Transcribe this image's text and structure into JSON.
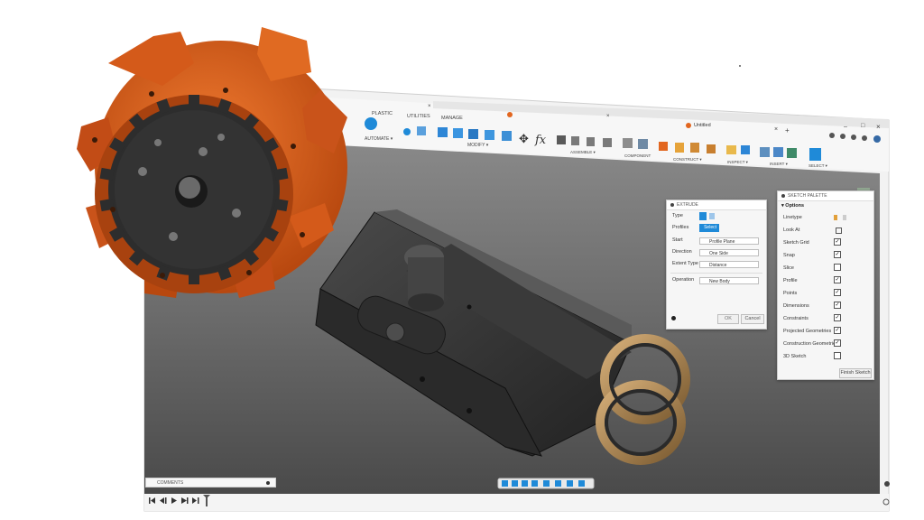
{
  "toolbar": {
    "tabs": [
      "PLASTIC",
      "UTILITIES",
      "MANAGE"
    ],
    "groups": [
      "AUTOMATE ▾",
      "MODIFY ▾",
      "ASSEMBLE ▾",
      "COMPONENT",
      "CONSTRUCT ▾",
      "INSPECT ▾",
      "INSERT ▾",
      "SELECT ▾"
    ]
  },
  "document_tab": {
    "title": "Untitled",
    "close_glyph": "×",
    "add_glyph": "+"
  },
  "window_controls": {
    "minimize": "–",
    "maximize": "□",
    "close": "×"
  },
  "extrude": {
    "title": "EXTRUDE",
    "rows": [
      {
        "label": "Type",
        "value": ""
      },
      {
        "label": "Profiles",
        "value": "Select"
      },
      {
        "label": "Start",
        "value": "Profile Plane"
      },
      {
        "label": "Direction",
        "value": "One Side"
      },
      {
        "label": "Extent Type",
        "value": "Distance"
      },
      {
        "label": "Operation",
        "value": "New Body"
      }
    ],
    "ok": "OK",
    "cancel": "Cancel"
  },
  "sketch_palette": {
    "title": "SKETCH PALETTE",
    "section": "Options",
    "rows": [
      {
        "label": "Linetype",
        "checked": null
      },
      {
        "label": "Look At",
        "checked": null
      },
      {
        "label": "Sketch Grid",
        "checked": true
      },
      {
        "label": "Snap",
        "checked": true
      },
      {
        "label": "Slice",
        "checked": false
      },
      {
        "label": "Profile",
        "checked": true
      },
      {
        "label": "Points",
        "checked": true
      },
      {
        "label": "Dimensions",
        "checked": true
      },
      {
        "label": "Constraints",
        "checked": true
      },
      {
        "label": "Projected Geometries",
        "checked": true
      },
      {
        "label": "Construction Geometries",
        "checked": true
      },
      {
        "label": "3D Sketch",
        "checked": false
      }
    ],
    "finish": "Finish Sketch"
  },
  "comments": {
    "label": "COMMENTS"
  },
  "colors": {
    "accent": "#1f8ad8",
    "orange": "#e2661f",
    "viewport": "#5f5f5f",
    "bronze": "#b08a55"
  }
}
